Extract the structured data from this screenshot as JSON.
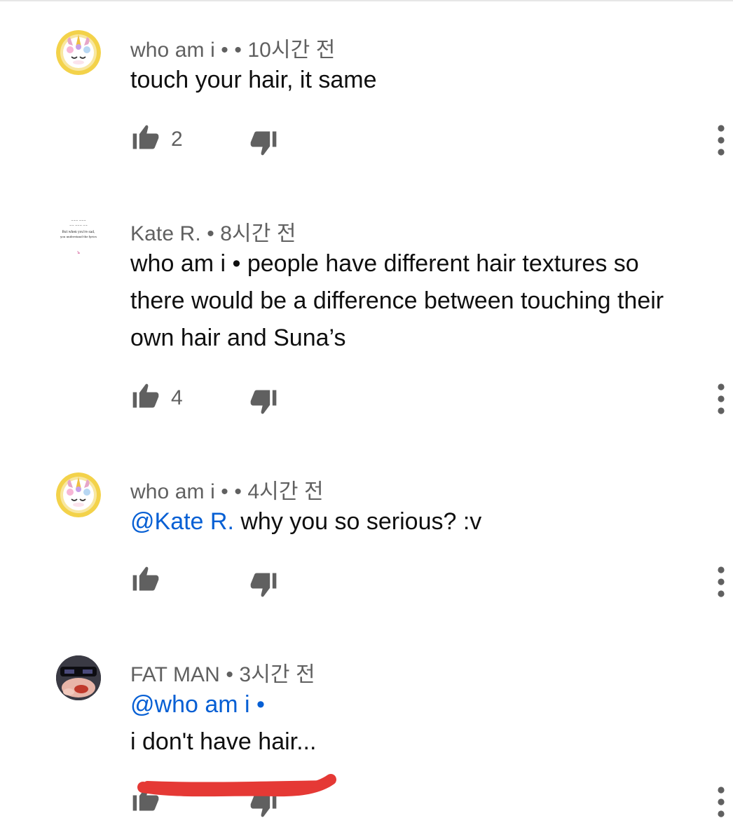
{
  "comments": [
    {
      "author": "who am i",
      "separator": "• •",
      "time": "10시간 전",
      "body_lines": [
        "touch your hair, it same"
      ],
      "likes": "2",
      "icons": {
        "like": "thumb-up-icon",
        "dislike": "thumb-down-icon",
        "more": "more-vert-icon"
      }
    },
    {
      "author": "Kate R.",
      "separator": "•",
      "time": "8시간 전",
      "body_lines": [
        "who am i • people have different hair textures so",
        "there would be a difference between touching their",
        "own hair and Suna’s"
      ],
      "likes": "4",
      "avatar_text": [
        "But when you're sad,",
        "you understand the lyrics"
      ]
    },
    {
      "author": "who am i",
      "separator": "• •",
      "time": "4시간 전",
      "mention": "@Kate R.",
      "body_rest": " why you so serious? :v",
      "likes": ""
    },
    {
      "author": "FAT MAN",
      "separator": "•",
      "time": "3시간 전",
      "mention": "@who am i •",
      "body_lines": [
        "i don't have hair..."
      ],
      "likes": ""
    }
  ],
  "colors": {
    "meta": "#606060",
    "text": "#0f0f0f",
    "mention": "#065fd4",
    "scribble": "#e53935"
  }
}
